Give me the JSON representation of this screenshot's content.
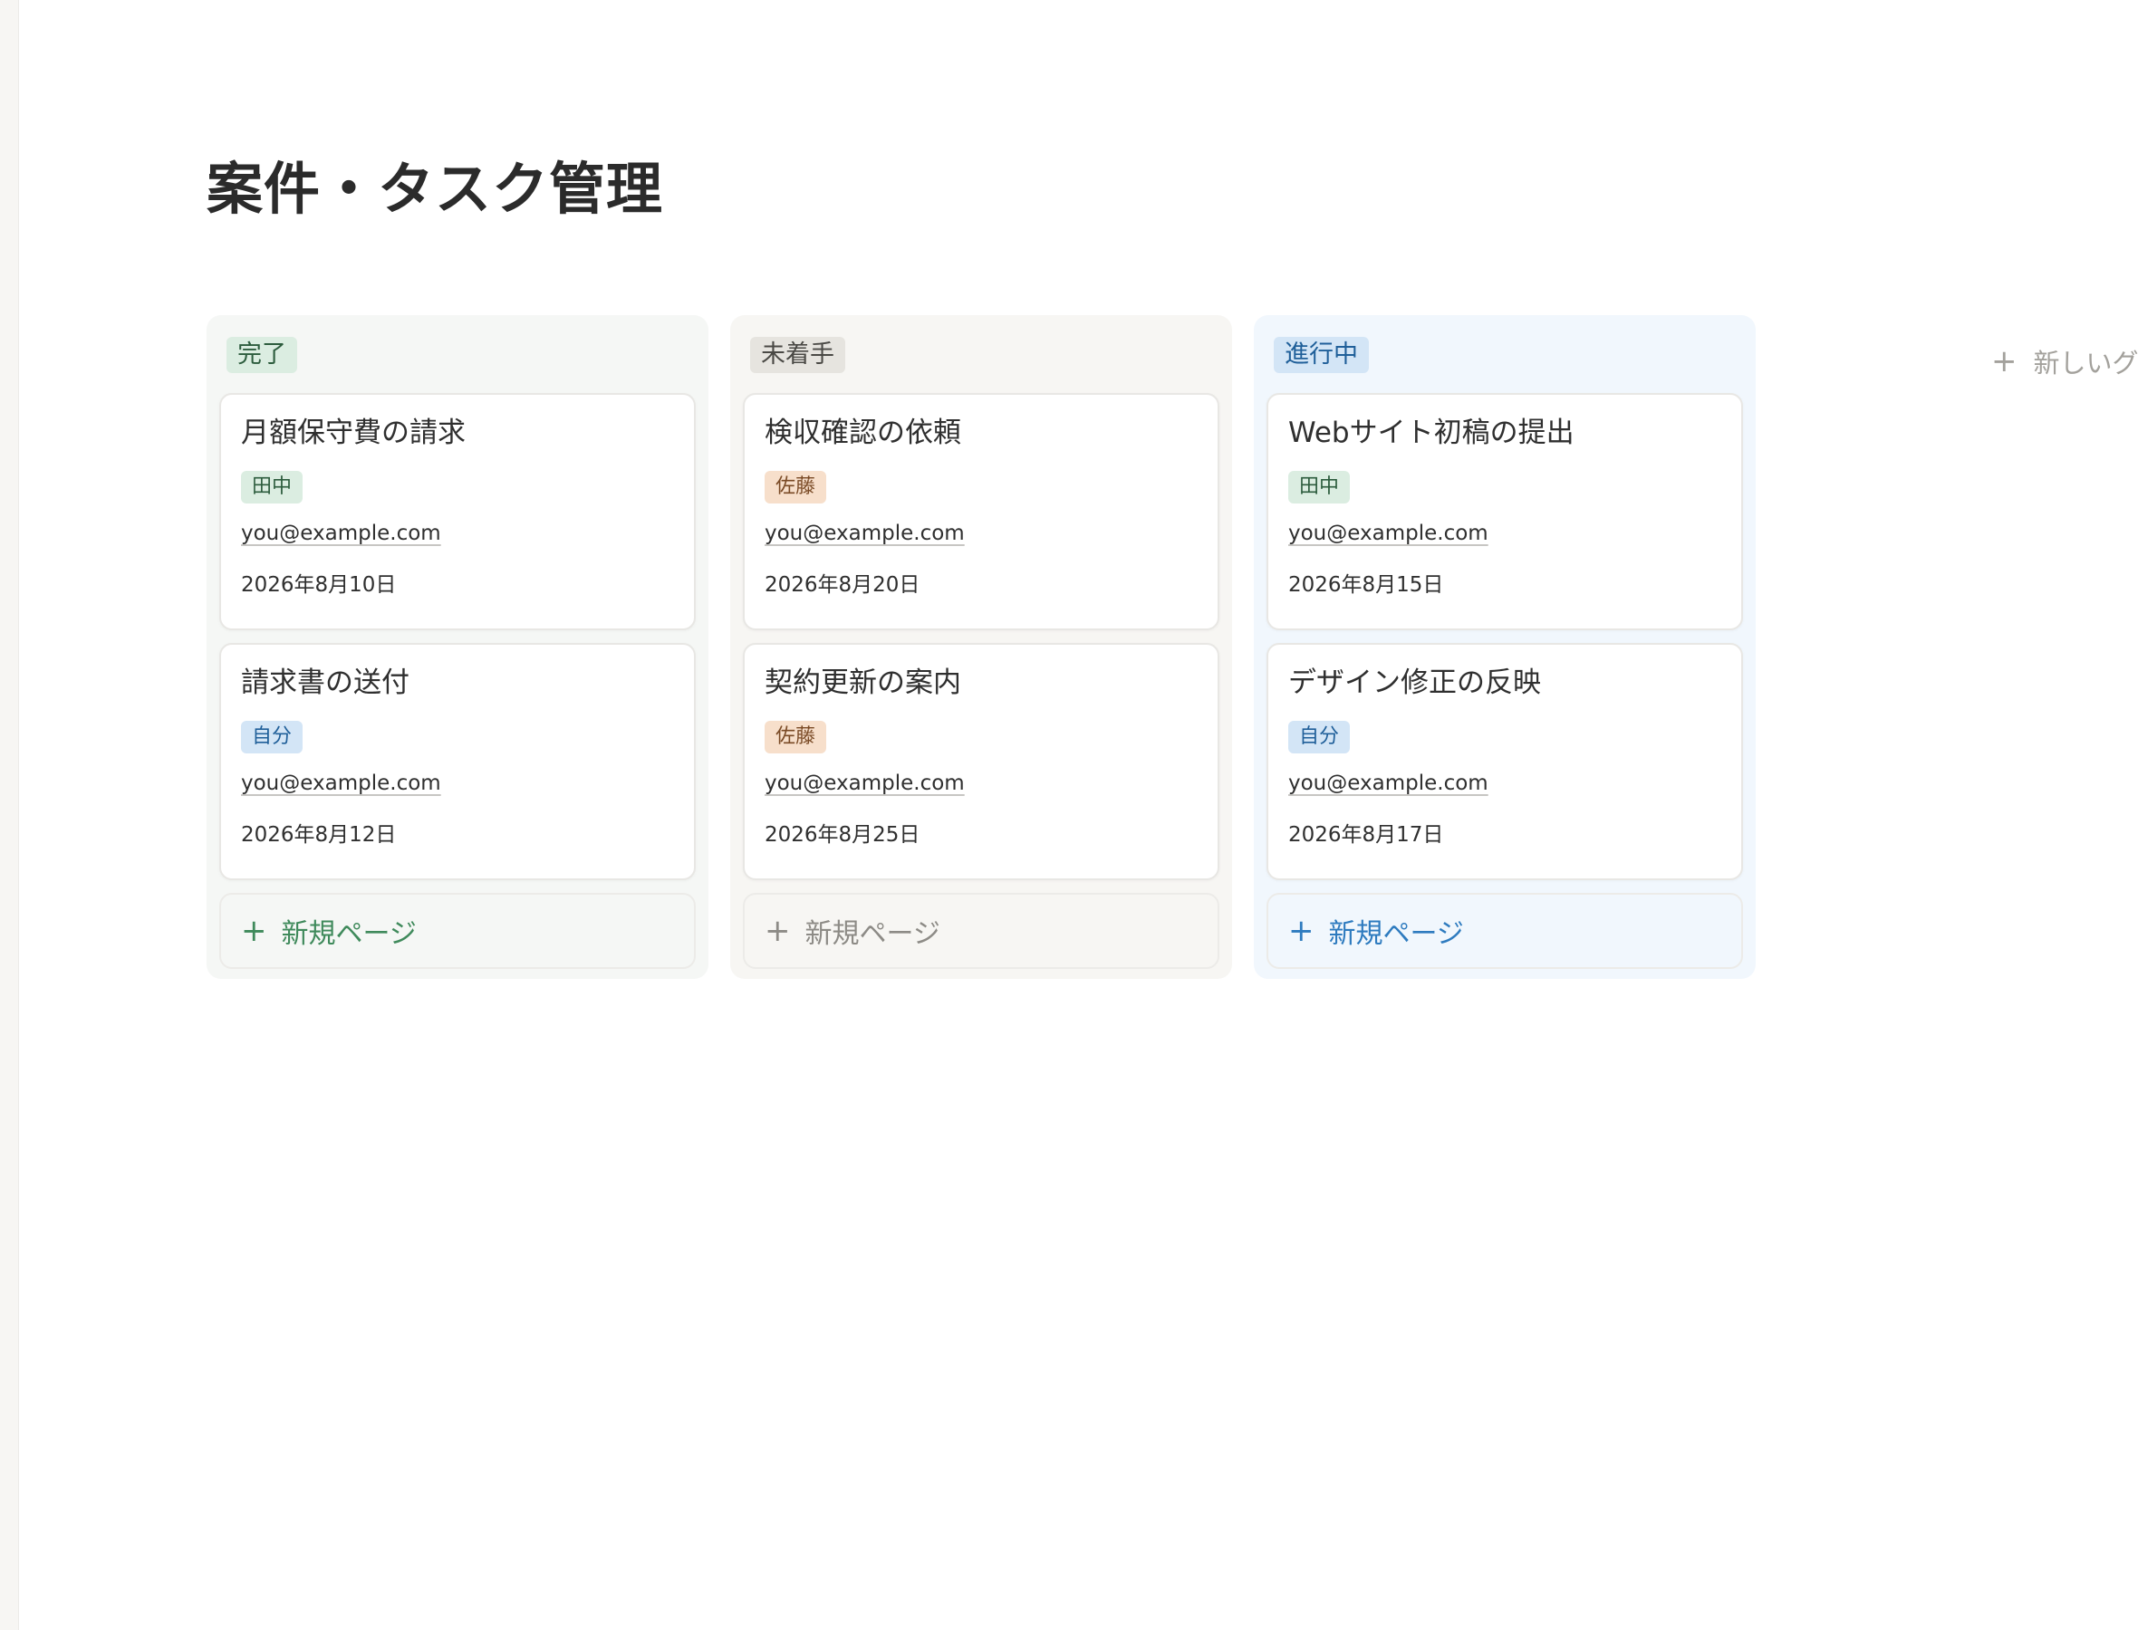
{
  "page": {
    "title": "案件・タスク管理"
  },
  "board": {
    "columns": [
      {
        "group": "完了",
        "cards": [
          {
            "title": "月額保守費の請求",
            "assignee": "田中",
            "email": "you@example.com",
            "date": "2026年8月10日"
          },
          {
            "title": "請求書の送付",
            "assignee": "自分",
            "email": "you@example.com",
            "date": "2026年8月12日"
          }
        ],
        "new_page_label": "新規ページ"
      },
      {
        "group": "未着手",
        "cards": [
          {
            "title": "検収確認の依頼",
            "assignee": "佐藤",
            "email": "you@example.com",
            "date": "2026年8月20日"
          },
          {
            "title": "契約更新の案内",
            "assignee": "佐藤",
            "email": "you@example.com",
            "date": "2026年8月25日"
          }
        ],
        "new_page_label": "新規ページ"
      },
      {
        "group": "進行中",
        "cards": [
          {
            "title": "Webサイト初稿の提出",
            "assignee": "田中",
            "email": "you@example.com",
            "date": "2026年8月15日"
          },
          {
            "title": "デザイン修正の反映",
            "assignee": "自分",
            "email": "you@example.com",
            "date": "2026年8月17日"
          }
        ],
        "new_page_label": "新規ページ"
      }
    ],
    "new_group_label": "新しいグループ"
  },
  "icons": {
    "plus": "plus-icon"
  },
  "colors": {
    "done_bg": "#f5f7f5",
    "todo_bg": "#f7f6f3",
    "progress_bg": "#f1f7fd",
    "green_tag": "#dbede1",
    "blue_tag": "#d3e5f6",
    "orange_tag": "#f7dfcb",
    "gray_tag": "#e6e4df"
  }
}
